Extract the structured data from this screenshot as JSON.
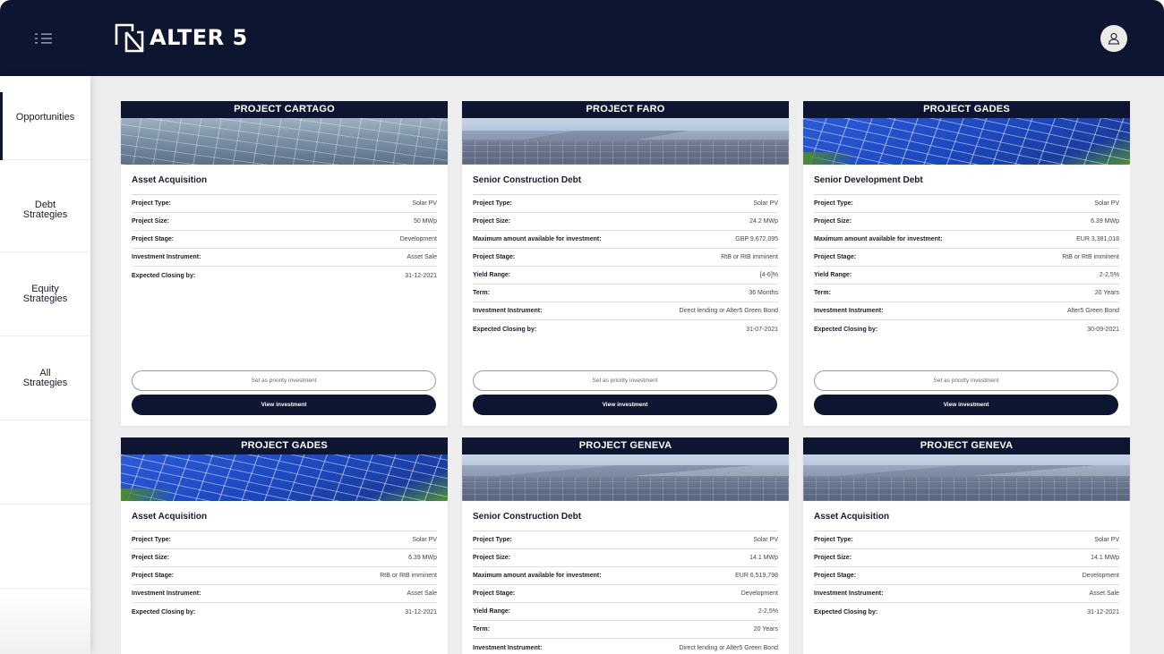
{
  "header": {
    "brand": "ALTER 5",
    "menu_icon": "hamburger-list-icon",
    "avatar_icon": "user-avatar-icon",
    "colors": {
      "navy": "#0e1530",
      "background": "#eeeeee"
    }
  },
  "sidebar": {
    "items": [
      {
        "label": "Opportunities",
        "active": true
      },
      {
        "label": "Debt\nStrategies",
        "active": false
      },
      {
        "label": "Equity\nStrategies",
        "active": false
      },
      {
        "label": "All\nStrategies",
        "active": false
      }
    ]
  },
  "cards": [
    {
      "project": "PROJECT CARTAGO",
      "image": "solar-panels-sky",
      "title": "Asset Acquisition",
      "rows": [
        {
          "label": "Project Type:",
          "value": "Solar PV"
        },
        {
          "label": "Project Size:",
          "value": "50 MWp"
        },
        {
          "label": "Project Stage:",
          "value": "Development"
        },
        {
          "label": "Investment Instrument:",
          "value": "Asset Sale"
        },
        {
          "label": "Expected Closing by:",
          "value": "31-12-2021"
        }
      ],
      "priority_button": "Set as priority investment",
      "view_button": "View investment"
    },
    {
      "project": "PROJECT FARO",
      "image": "solar-panels-mountains",
      "title": "Senior Construction Debt",
      "rows": [
        {
          "label": "Project Type:",
          "value": "Solar PV"
        },
        {
          "label": "Project Size:",
          "value": "24.2 MWp"
        },
        {
          "label": "Maximum amount available for investment:",
          "value": "GBP 9,672,095"
        },
        {
          "label": "Project Stage:",
          "value": "RtB or RtB imminent"
        },
        {
          "label": "Yield Range:",
          "value": "[4-6]%"
        },
        {
          "label": "Term:",
          "value": "36 Months"
        },
        {
          "label": "Investment Instrument:",
          "value": "Direct lending or Alter5 Green Bond"
        },
        {
          "label": "Expected Closing by:",
          "value": "31-07-2021"
        }
      ],
      "priority_button": "Set as priority investment",
      "view_button": "View investment"
    },
    {
      "project": "PROJECT GADES",
      "image": "solar-panels-blue",
      "title": "Senior Development Debt",
      "rows": [
        {
          "label": "Project Type:",
          "value": "Solar PV"
        },
        {
          "label": "Project Size:",
          "value": "6.39 MWp"
        },
        {
          "label": "Maximum amount available for investment:",
          "value": "EUR 3,381,018"
        },
        {
          "label": "Project Stage:",
          "value": "RtB or RtB imminent"
        },
        {
          "label": "Yield Range:",
          "value": "2-2,5%"
        },
        {
          "label": "Term:",
          "value": "20 Years"
        },
        {
          "label": "Investment Instrument:",
          "value": "Alter5 Green Bond"
        },
        {
          "label": "Expected Closing by:",
          "value": "30-09-2021"
        }
      ],
      "priority_button": "Set as priority investment",
      "view_button": "View investment"
    },
    {
      "project": "PROJECT GADES",
      "image": "solar-panels-blue",
      "title": "Asset Acquisition",
      "rows": [
        {
          "label": "Project Type:",
          "value": "Solar PV"
        },
        {
          "label": "Project Size:",
          "value": "6.39 MWp"
        },
        {
          "label": "Project Stage:",
          "value": "RtB or RtB imminent"
        },
        {
          "label": "Investment Instrument:",
          "value": "Asset Sale"
        },
        {
          "label": "Expected Closing by:",
          "value": "31-12-2021"
        }
      ]
    },
    {
      "project": "PROJECT GENEVA",
      "image": "solar-panels-mountains",
      "title": "Senior Construction Debt",
      "rows": [
        {
          "label": "Project Type:",
          "value": "Solar PV"
        },
        {
          "label": "Project Size:",
          "value": "14.1 MWp"
        },
        {
          "label": "Maximum amount available for investment:",
          "value": "EUR 6,519,798"
        },
        {
          "label": "Project Stage:",
          "value": "Development"
        },
        {
          "label": "Yield Range:",
          "value": "2-2,5%"
        },
        {
          "label": "Term:",
          "value": "20 Years"
        },
        {
          "label": "Investment Instrument:",
          "value": "Direct lending or Alter5 Green Bond"
        }
      ]
    },
    {
      "project": "PROJECT GENEVA",
      "image": "solar-panels-mountains",
      "title": "Asset Acquisition",
      "rows": [
        {
          "label": "Project Type:",
          "value": "Solar PV"
        },
        {
          "label": "Project Size:",
          "value": "14.1 MWp"
        },
        {
          "label": "Project Stage:",
          "value": "Development"
        },
        {
          "label": "Investment Instrument:",
          "value": "Asset Sale"
        },
        {
          "label": "Expected Closing by:",
          "value": "31-12-2021"
        }
      ]
    }
  ]
}
